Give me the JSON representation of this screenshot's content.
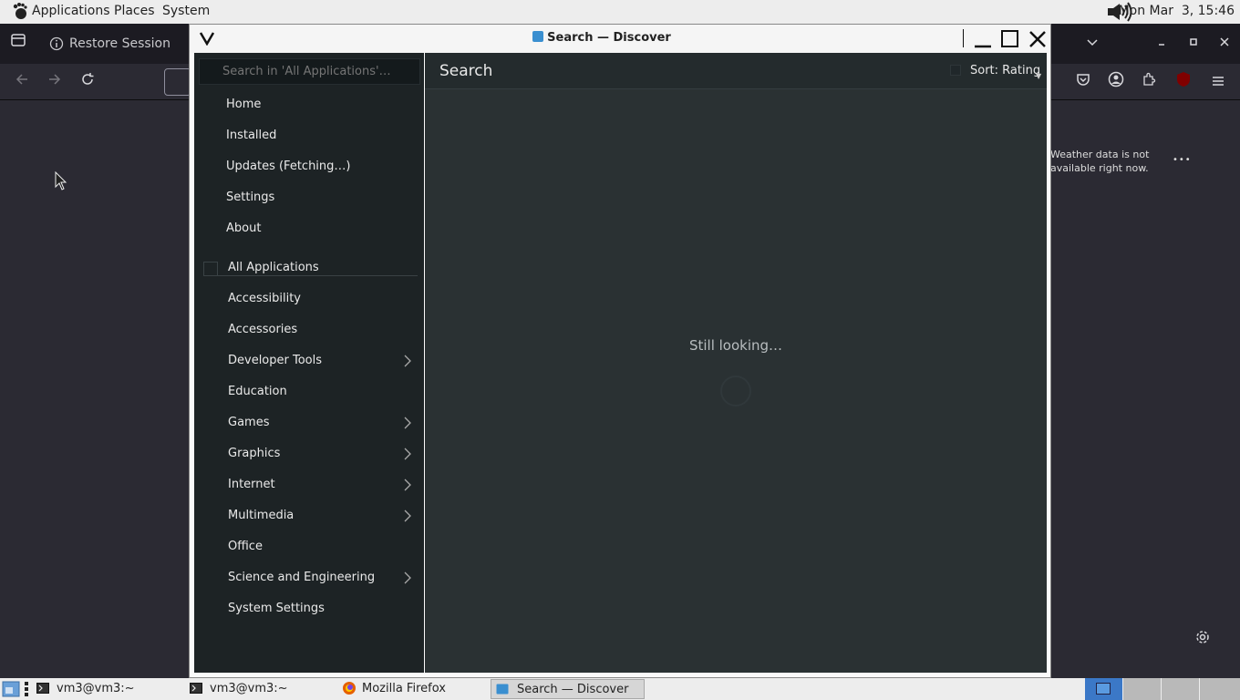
{
  "top_panel": {
    "menu_applications": "Applications",
    "menu_places": "Places",
    "menu_system": "System",
    "clock": "Mon Mar  3, 15:46"
  },
  "firefox": {
    "tab_label": "Restore Session",
    "weather_line1": "Weather data is not",
    "weather_line2": "available right now.",
    "more_dots": "•••"
  },
  "discover": {
    "window_title": "Search — Discover",
    "search_placeholder": "Search in 'All Applications'…",
    "page_title": "Search",
    "sort_label": "Sort: Rating",
    "status": "Still looking…",
    "nav": [
      "Home",
      "Installed",
      "Updates (Fetching…)",
      "Settings",
      "About"
    ],
    "categories": [
      {
        "label": "All Applications",
        "has_sub": false
      },
      {
        "label": "Accessibility",
        "has_sub": false
      },
      {
        "label": "Accessories",
        "has_sub": false
      },
      {
        "label": "Developer Tools",
        "has_sub": true
      },
      {
        "label": "Education",
        "has_sub": false
      },
      {
        "label": "Games",
        "has_sub": true
      },
      {
        "label": "Graphics",
        "has_sub": true
      },
      {
        "label": "Internet",
        "has_sub": true
      },
      {
        "label": "Multimedia",
        "has_sub": true
      },
      {
        "label": "Office",
        "has_sub": false
      },
      {
        "label": "Science and Engineering",
        "has_sub": true
      },
      {
        "label": "System Settings",
        "has_sub": false
      }
    ]
  },
  "taskbar": {
    "tasks": [
      "vm3@vm3:~",
      "vm3@vm3:~",
      "Mozilla Firefox",
      "Search — Discover"
    ]
  },
  "colors": {
    "accent": "#3b78c7",
    "discover_sidebar": "#1d2325",
    "discover_main": "#2a3133"
  }
}
